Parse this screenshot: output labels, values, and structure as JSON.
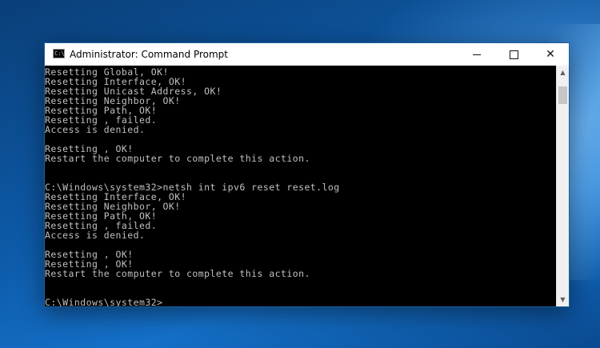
{
  "window": {
    "title": "Administrator: Command Prompt",
    "icon": "cmd-icon",
    "icon_text": "C:\\",
    "minimize_icon": "minimize-icon",
    "maximize_icon": "maximize-icon",
    "close_label": "✕"
  },
  "console": {
    "background": "#000000",
    "text_color": "#c0c0c0",
    "lines": [
      "Resetting Global, OK!",
      "Resetting Interface, OK!",
      "Resetting Unicast Address, OK!",
      "Resetting Neighbor, OK!",
      "Resetting Path, OK!",
      "Resetting , failed.",
      "Access is denied.",
      "",
      "Resetting , OK!",
      "Restart the computer to complete this action.",
      "",
      "",
      "C:\\Windows\\system32>netsh int ipv6 reset reset.log",
      "Resetting Interface, OK!",
      "Resetting Neighbor, OK!",
      "Resetting Path, OK!",
      "Resetting , failed.",
      "Access is denied.",
      "",
      "Resetting , OK!",
      "Resetting , OK!",
      "Restart the computer to complete this action.",
      "",
      "",
      "C:\\Windows\\system32>"
    ]
  },
  "scrollbar": {
    "up_arrow": "▲",
    "down_arrow": "▼",
    "position_fraction": 0.1
  }
}
